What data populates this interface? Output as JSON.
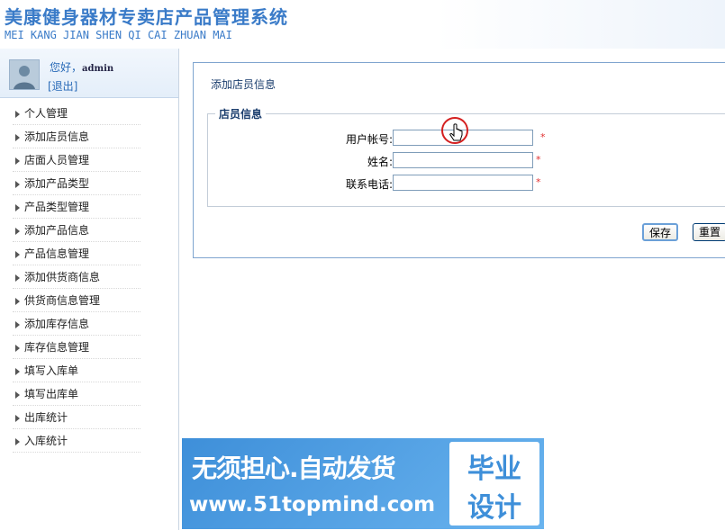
{
  "header": {
    "title": "美康健身器材专卖店产品管理系统",
    "subtitle": "MEI KANG JIAN SHEN QI CAI ZHUAN MAI"
  },
  "user": {
    "greeting": "您好，",
    "name": "admin",
    "logout": "[退出]"
  },
  "menu": {
    "items": [
      {
        "label": "个人管理"
      },
      {
        "label": "添加店员信息"
      },
      {
        "label": "店面人员管理"
      },
      {
        "label": "添加产品类型"
      },
      {
        "label": "产品类型管理"
      },
      {
        "label": "添加产品信息"
      },
      {
        "label": "产品信息管理"
      },
      {
        "label": "添加供货商信息"
      },
      {
        "label": "供货商信息管理"
      },
      {
        "label": "添加库存信息"
      },
      {
        "label": "库存信息管理"
      },
      {
        "label": "填写入库单"
      },
      {
        "label": "填写出库单"
      },
      {
        "label": "出库统计"
      },
      {
        "label": "入库统计"
      }
    ]
  },
  "panel": {
    "title": "添加店员信息",
    "fieldset_legend": "店员信息",
    "fields": {
      "account": {
        "label": "用户帐号:",
        "value": "",
        "required": "*"
      },
      "name": {
        "label": "姓名:",
        "value": "",
        "required": "*"
      },
      "phone": {
        "label": "联系电话:",
        "value": "",
        "required": "*"
      }
    },
    "buttons": {
      "save": "保存",
      "reset": "重置"
    }
  },
  "banner": {
    "line1": "无须担心.自动发货",
    "line2": "www.51topmind.com",
    "box_line1": "毕业",
    "box_line2": "设计"
  },
  "colors": {
    "accent": "#3a7bc8",
    "panel_border": "#7fa5cf",
    "required": "#e03030",
    "banner": "#3e8fd9"
  }
}
